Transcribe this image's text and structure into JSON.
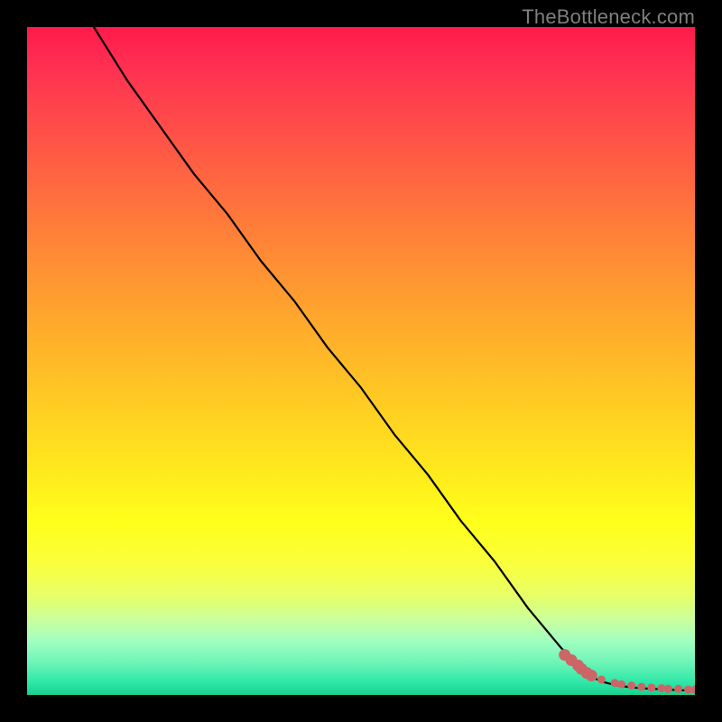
{
  "watermark": "TheBottleneck.com",
  "chart_data": {
    "type": "line",
    "title": "",
    "xlabel": "",
    "ylabel": "",
    "xlim": [
      0,
      100
    ],
    "ylim": [
      0,
      100
    ],
    "grid": false,
    "legend": false,
    "background": "red-yellow-green vertical gradient (bottleneck severity colormap)",
    "series": [
      {
        "name": "bottleneck-curve",
        "color": "#000000",
        "x": [
          10,
          15,
          20,
          25,
          30,
          35,
          40,
          45,
          50,
          55,
          60,
          65,
          70,
          75,
          80,
          82,
          84,
          86,
          88,
          90,
          92,
          94,
          96,
          98,
          100
        ],
        "y": [
          100,
          92,
          85,
          78,
          72,
          65,
          59,
          52,
          46,
          39,
          33,
          26,
          20,
          13,
          7,
          5,
          3,
          2,
          1.5,
          1.2,
          1.0,
          0.9,
          0.8,
          0.7,
          0.7
        ]
      },
      {
        "name": "data-points",
        "color": "#cc6666",
        "marker": "circle",
        "x": [
          80.5,
          81.5,
          82.5,
          83.0,
          83.8,
          84.5,
          86.0,
          88.0,
          89.0,
          90.5,
          92.0,
          93.5,
          95.0,
          96.0,
          97.5,
          99.0,
          100.0
        ],
        "y": [
          6.0,
          5.2,
          4.4,
          3.9,
          3.3,
          2.9,
          2.3,
          1.8,
          1.6,
          1.4,
          1.2,
          1.1,
          1.0,
          0.9,
          0.9,
          0.8,
          0.8
        ]
      }
    ]
  }
}
